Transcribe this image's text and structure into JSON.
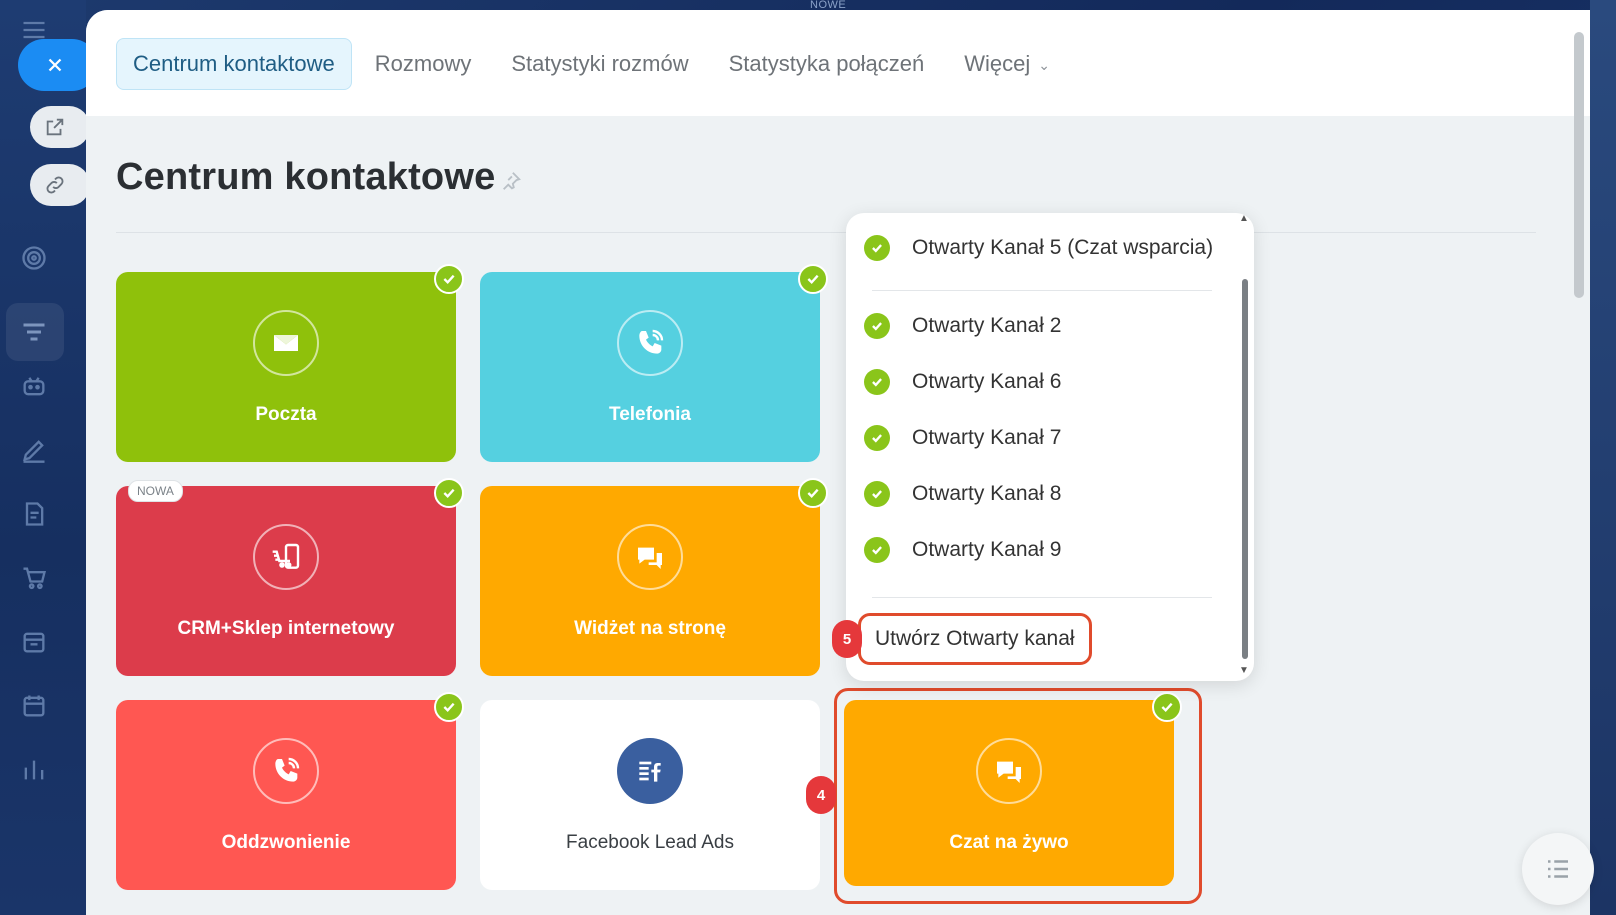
{
  "top_label": "NOWE",
  "tabs": [
    {
      "label": "Centrum kontaktowe",
      "active": true
    },
    {
      "label": "Rozmowy",
      "active": false
    },
    {
      "label": "Statystyki rozmów",
      "active": false
    },
    {
      "label": "Statystyka połączeń",
      "active": false
    },
    {
      "label": "Więcej",
      "active": false
    }
  ],
  "page_title": "Centrum kontaktowe",
  "tiles": [
    {
      "label": "Poczta",
      "color": "#8fc10b",
      "icon": "mail-icon",
      "connected": true
    },
    {
      "label": "Telefonia",
      "color": "#55d0e0",
      "icon": "phone-icon",
      "connected": true
    },
    {
      "label": "CRM+Sklep internetowy",
      "color": "#dc3c4b",
      "icon": "cart-icon",
      "connected": true,
      "badge": "NOWA"
    },
    {
      "label": "Widżet na stronę",
      "color": "#ffa900",
      "icon": "chat-icon",
      "connected": true
    },
    {
      "label": "Oddzwonienie",
      "color": "#ff5752",
      "icon": "phone-icon",
      "connected": true
    },
    {
      "label": "Facebook Lead Ads",
      "color": "#ffffff",
      "icon": "facebook-leads-icon",
      "connected": false
    },
    {
      "label": "Czat na żywo",
      "color": "#ffa900",
      "icon": "chat-icon",
      "connected": true
    }
  ],
  "popup": {
    "items": [
      "Otwarty Kanał 5 (Czat wsparcia)",
      "Otwarty Kanał 2",
      "Otwarty Kanał 6",
      "Otwarty Kanał 7",
      "Otwarty Kanał 8",
      "Otwarty Kanał 9"
    ],
    "create_label": "Utwórz Otwarty kanał"
  },
  "steps": {
    "step4": "4",
    "step5": "5"
  },
  "colors": {
    "accent": "#1b8cf3",
    "check": "#8ac51a",
    "highlight": "#e04b2c"
  }
}
